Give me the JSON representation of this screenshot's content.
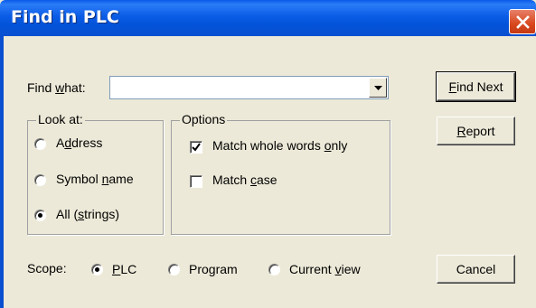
{
  "window": {
    "title": "Find in PLC",
    "close_icon": "close-icon"
  },
  "find_what": {
    "label_prefix": "Find ",
    "label_accel": "w",
    "label_suffix": "hat:",
    "value": ""
  },
  "look_at": {
    "legend": "Look at:",
    "options": [
      {
        "pre": "A",
        "accel": "d",
        "post": "dress",
        "selected": false
      },
      {
        "pre": "Symbol ",
        "accel": "n",
        "post": "ame",
        "selected": false
      },
      {
        "pre": "All (",
        "accel": "s",
        "post": "trings)",
        "selected": true
      }
    ]
  },
  "options": {
    "legend": "Options",
    "whole_words": {
      "pre": "Match whole words ",
      "accel": "o",
      "post": "nly",
      "checked": true
    },
    "match_case": {
      "pre": "Match ",
      "accel": "c",
      "post": "ase",
      "checked": false
    }
  },
  "scope": {
    "label": "Scope:",
    "options": [
      {
        "pre": "",
        "accel": "P",
        "post": "LC",
        "selected": true
      },
      {
        "pre": "Program",
        "accel": "",
        "post": "",
        "selected": false
      },
      {
        "pre": "Current ",
        "accel": "v",
        "post": "iew",
        "selected": false
      }
    ]
  },
  "buttons": {
    "find_next": {
      "accel": "F",
      "rest": "ind Next"
    },
    "report": {
      "accel": "R",
      "rest": "eport"
    },
    "cancel": "Cancel"
  }
}
